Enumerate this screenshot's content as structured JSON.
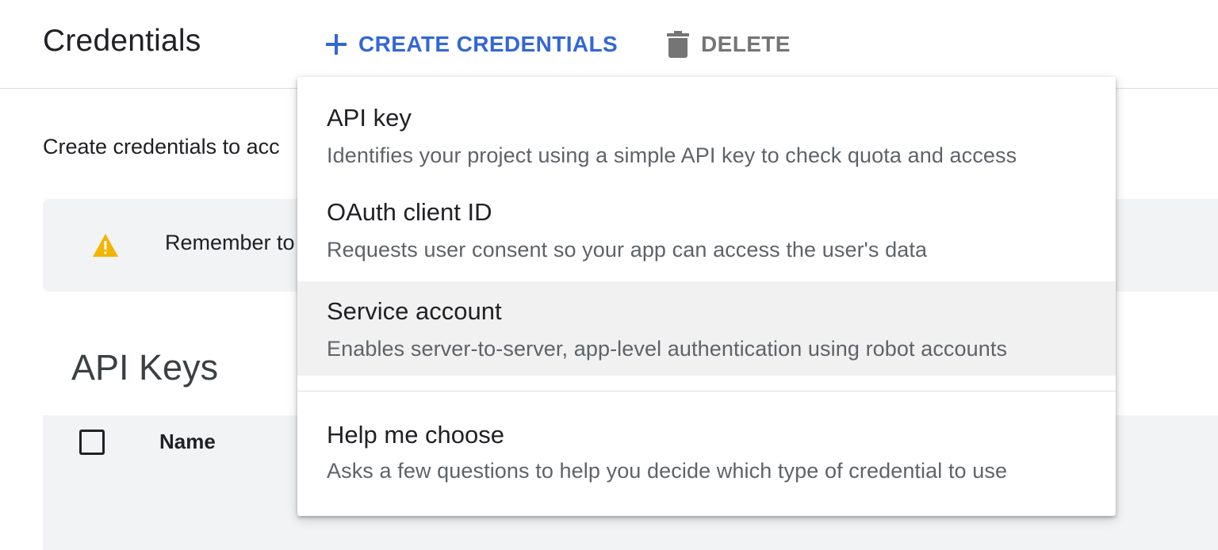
{
  "header": {
    "title": "Credentials",
    "create_label": "CREATE CREDENTIALS",
    "delete_label": "DELETE"
  },
  "content": {
    "intro_text": "Create credentials to acc",
    "banner_text": "Remember to",
    "section_title": "API Keys",
    "table": {
      "name_column": "Name"
    }
  },
  "menu": {
    "items": [
      {
        "title": "API key",
        "description": "Identifies your project using a simple API key to check quota and access"
      },
      {
        "title": "OAuth client ID",
        "description": "Requests user consent so your app can access the user's data"
      },
      {
        "title": "Service account",
        "description": "Enables server-to-server, app-level authentication using robot accounts"
      },
      {
        "title": "Help me choose",
        "description": "Asks a few questions to help you decide which type of credential to use"
      }
    ],
    "highlighted_item": "Service account"
  },
  "icons": {
    "create": "plus-icon",
    "delete": "trash-icon",
    "banner": "warning-icon"
  },
  "colors": {
    "accent": "#3367d6",
    "warning": "#f4b400",
    "muted": "#757575"
  }
}
